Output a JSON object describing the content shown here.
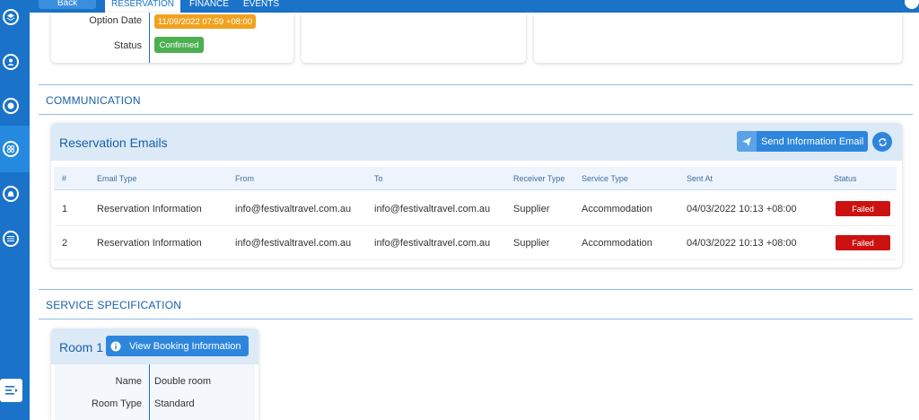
{
  "topbar": {
    "back_label": "Back",
    "tabs": [
      {
        "label": "RESERVATION",
        "active": true
      },
      {
        "label": "FINANCE",
        "active": false
      },
      {
        "label": "EVENTS",
        "active": false
      }
    ]
  },
  "summary": {
    "option_date_label": "Option Date",
    "option_date_value": "11/09/2022 07:59 +08:00",
    "status_label": "Status",
    "status_value": "Confirmed"
  },
  "communication": {
    "section_title": "COMMUNICATION",
    "card_title": "Reservation Emails",
    "send_button": "Send Information Email",
    "columns": [
      "#",
      "Email Type",
      "From",
      "To",
      "Receiver Type",
      "Service Type",
      "Sent At",
      "Status"
    ],
    "rows": [
      {
        "num": "1",
        "email_type": "Reservation Information",
        "from": "info@festivaltravel.com.au",
        "to": "info@festivaltravel.com.au",
        "receiver_type": "Supplier",
        "service_type": "Accommodation",
        "sent_at": "04/03/2022 10:13 +08:00",
        "status": "Failed"
      },
      {
        "num": "2",
        "email_type": "Reservation Information",
        "from": "info@festivaltravel.com.au",
        "to": "info@festivaltravel.com.au",
        "receiver_type": "Supplier",
        "service_type": "Accommodation",
        "sent_at": "04/03/2022 10:13 +08:00",
        "status": "Failed"
      }
    ]
  },
  "service": {
    "section_title": "SERVICE SPECIFICATION",
    "room_title": "Room 1",
    "view_button": "View Booking Information",
    "name_label": "Name",
    "name_value": "Double room",
    "room_type_label": "Room Type",
    "room_type_value": "Standard"
  },
  "colors": {
    "brand": "#1a73c9",
    "option_date_badge": "#f0a21f",
    "confirmed_badge": "#4caf50",
    "failed_badge": "#cc1111"
  }
}
